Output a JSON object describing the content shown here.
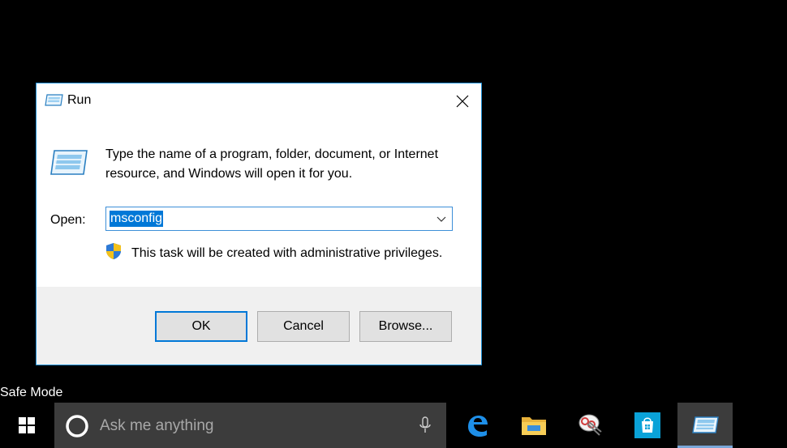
{
  "dialog": {
    "title": "Run",
    "description": "Type the name of a program, folder, document, or Internet resource, and Windows will open it for you.",
    "open_label": "Open:",
    "open_value": "msconfig",
    "admin_note": "This task will be created with administrative privileges.",
    "buttons": {
      "ok": "OK",
      "cancel": "Cancel",
      "browse": "Browse..."
    }
  },
  "desktop": {
    "mode_label": "Safe Mode"
  },
  "taskbar": {
    "search_placeholder": "Ask me anything",
    "apps": [
      "edge-icon",
      "file-explorer-icon",
      "snipping-tool-icon",
      "store-icon",
      "run-icon"
    ]
  },
  "colors": {
    "accent": "#0078d7",
    "dialog_border": "#1e90d6",
    "search_bg": "#3c3c3c"
  }
}
